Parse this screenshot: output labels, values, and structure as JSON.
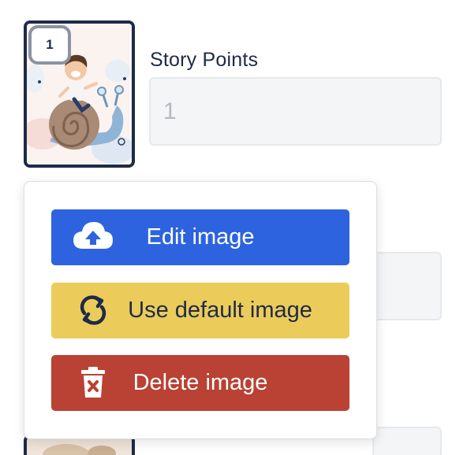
{
  "card": {
    "badge_number": "1",
    "image_description_icon": "snail-rider-illustration"
  },
  "story_points": {
    "label": "Story Points",
    "value": "",
    "placeholder": "1"
  },
  "image_menu": {
    "edit_label": "Edit image",
    "edit_icon": "cloud-upload-icon",
    "default_label": "Use default image",
    "default_icon": "refresh-icon",
    "delete_label": "Delete image",
    "delete_icon": "trash-icon"
  },
  "colors": {
    "edit_bg": "#2d63de",
    "default_bg": "#ebcc5a",
    "delete_bg": "#b94234",
    "card_border": "#1e2a48",
    "badge_border": "#8b93a3"
  }
}
